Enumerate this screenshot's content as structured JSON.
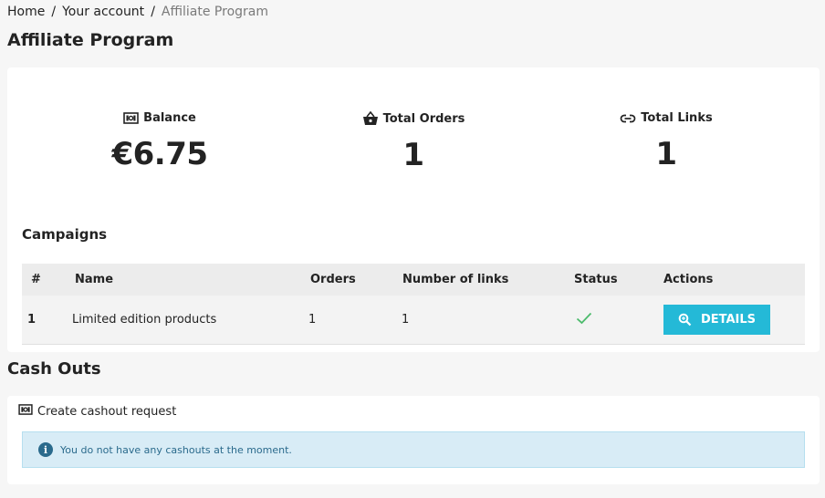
{
  "breadcrumb": {
    "items": [
      "Home",
      "Your account"
    ],
    "separator": "/",
    "current": "Affiliate Program"
  },
  "page_title": "Affiliate Program",
  "stats": {
    "balance": {
      "label": "Balance",
      "value": "€6.75",
      "icon": "money-icon"
    },
    "orders": {
      "label": "Total Orders",
      "value": "1",
      "icon": "basket-icon"
    },
    "links": {
      "label": "Total Links",
      "value": "1",
      "icon": "link-icon"
    }
  },
  "campaigns": {
    "title": "Campaigns",
    "columns": [
      "#",
      "Name",
      "Orders",
      "Number of links",
      "Status",
      "Actions"
    ],
    "rows": [
      {
        "id": "1",
        "name": "Limited edition products",
        "orders": "1",
        "links": "1",
        "status": "active",
        "action": "DETAILS"
      }
    ],
    "status_color": "#4cbb6c",
    "button_color": "#24b9d7"
  },
  "cashouts": {
    "title": "Cash Outs",
    "create_label": "Create cashout request",
    "alert": "You do not have any cashouts at the moment."
  }
}
